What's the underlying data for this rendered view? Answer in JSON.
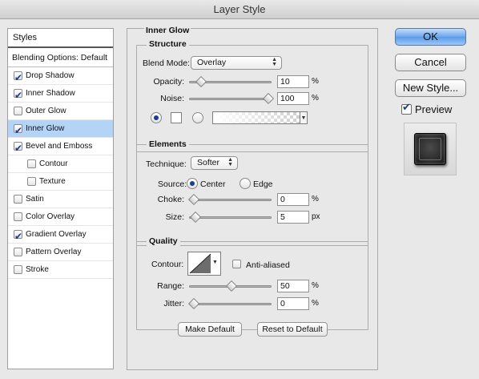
{
  "window": {
    "title": "Layer Style"
  },
  "styles_list": {
    "header": "Styles",
    "blending_options": "Blending Options: Default",
    "items": [
      {
        "label": "Drop Shadow",
        "checked": true,
        "sub": false,
        "active": false
      },
      {
        "label": "Inner Shadow",
        "checked": true,
        "sub": false,
        "active": false
      },
      {
        "label": "Outer Glow",
        "checked": false,
        "sub": false,
        "active": false
      },
      {
        "label": "Inner Glow",
        "checked": true,
        "sub": false,
        "active": true
      },
      {
        "label": "Bevel and Emboss",
        "checked": true,
        "sub": false,
        "active": false
      },
      {
        "label": "Contour",
        "checked": false,
        "sub": true,
        "active": false
      },
      {
        "label": "Texture",
        "checked": false,
        "sub": true,
        "active": false
      },
      {
        "label": "Satin",
        "checked": false,
        "sub": false,
        "active": false
      },
      {
        "label": "Color Overlay",
        "checked": false,
        "sub": false,
        "active": false
      },
      {
        "label": "Gradient Overlay",
        "checked": true,
        "sub": false,
        "active": false
      },
      {
        "label": "Pattern Overlay",
        "checked": false,
        "sub": false,
        "active": false
      },
      {
        "label": "Stroke",
        "checked": false,
        "sub": false,
        "active": false
      }
    ]
  },
  "panel": {
    "title": "Inner Glow",
    "structure": {
      "title": "Structure",
      "blend_mode_label": "Blend Mode:",
      "blend_mode_value": "Overlay",
      "opacity_label": "Opacity:",
      "opacity_value": "10",
      "opacity_unit": "%",
      "opacity_level": 0.1,
      "noise_label": "Noise:",
      "noise_value": "100",
      "noise_unit": "%",
      "noise_level": 1.0,
      "fill_mode": "solid-color"
    },
    "elements": {
      "title": "Elements",
      "technique_label": "Technique:",
      "technique_value": "Softer",
      "source_label": "Source:",
      "source_center": "Center",
      "source_edge": "Edge",
      "source_selected": "Center",
      "choke_label": "Choke:",
      "choke_value": "0",
      "choke_unit": "%",
      "choke_level": 0.0,
      "size_label": "Size:",
      "size_value": "5",
      "size_unit": "px",
      "size_level": 0.02
    },
    "quality": {
      "title": "Quality",
      "contour_label": "Contour:",
      "anti_aliased_label": "Anti-aliased",
      "anti_aliased_checked": false,
      "range_label": "Range:",
      "range_value": "50",
      "range_unit": "%",
      "range_level": 0.5,
      "jitter_label": "Jitter:",
      "jitter_value": "0",
      "jitter_unit": "%",
      "jitter_level": 0.0
    },
    "make_default": "Make Default",
    "reset_to_default": "Reset to Default"
  },
  "actions": {
    "ok": "OK",
    "cancel": "Cancel",
    "new_style": "New Style...",
    "preview_label": "Preview",
    "preview_checked": true
  }
}
